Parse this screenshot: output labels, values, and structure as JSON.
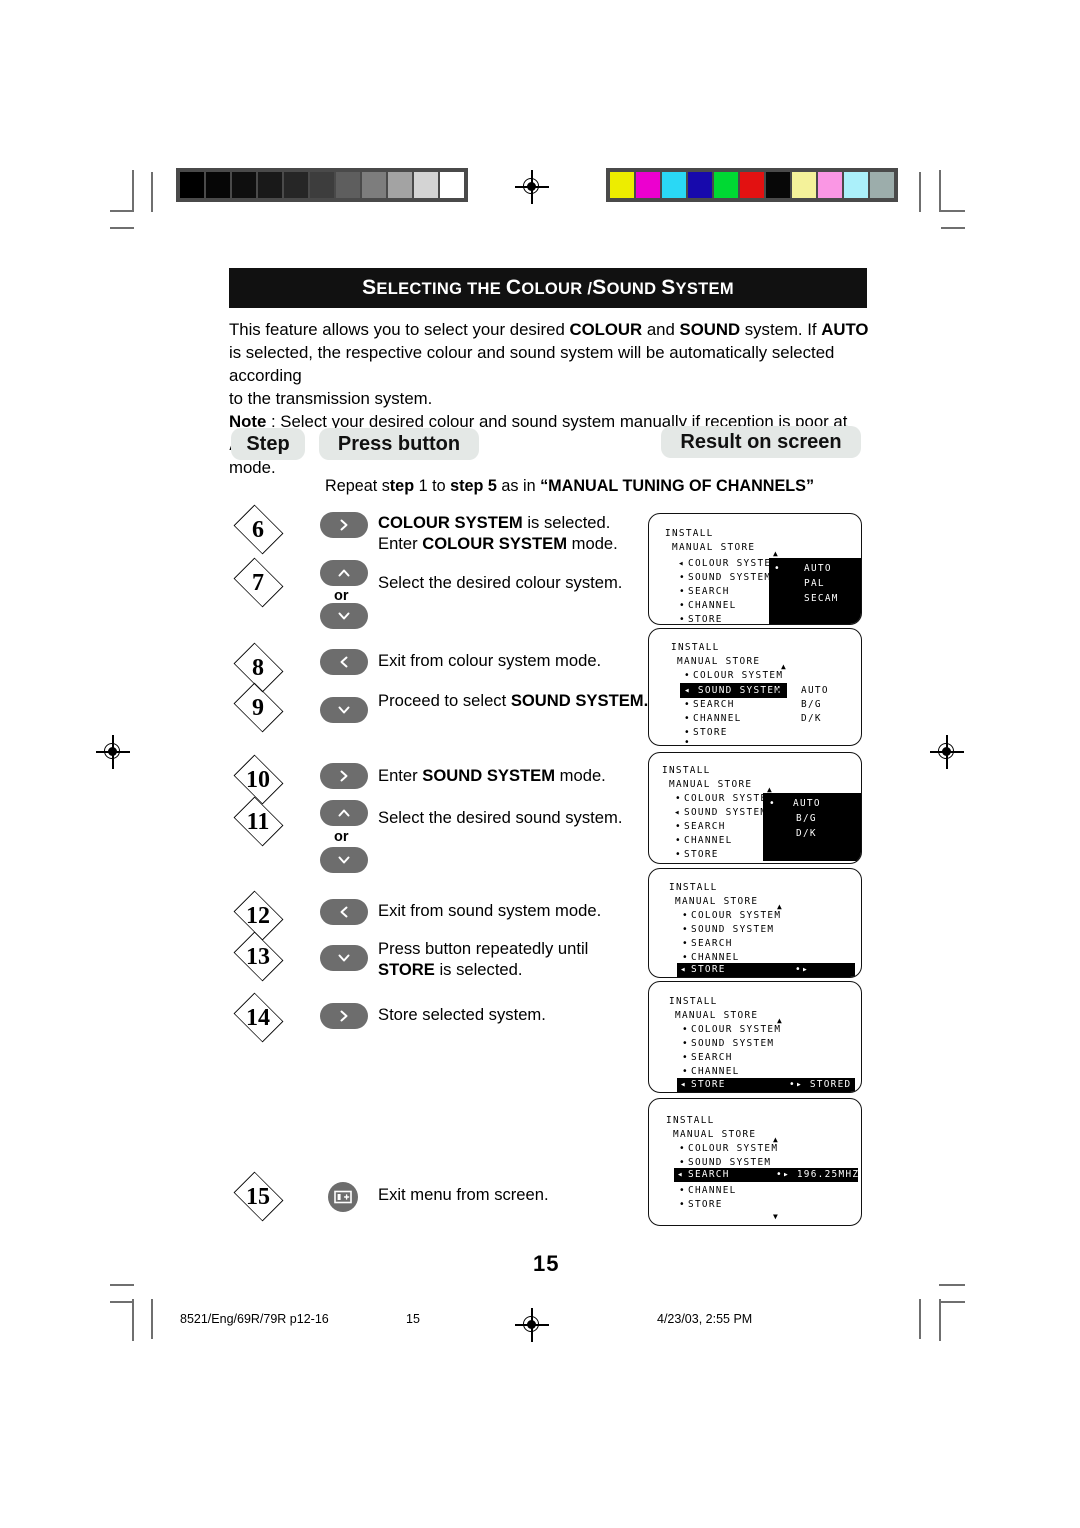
{
  "document": {
    "title": "SELECTING THE COLOUR /SOUND SYSTEM",
    "title_parts": {
      "s1": "S",
      "w1": "ELECTING THE ",
      "s2": "C",
      "w2": "OLOUR /",
      "s3": "S",
      "w3": "OUND ",
      "s4": "S",
      "w4": "YSTEM"
    },
    "page_number": "15"
  },
  "intro": {
    "l1_a": "This feature allows you to select your desired ",
    "l1_b": "COLOUR",
    "l1_c": " and ",
    "l1_d": "SOUND",
    "l1_e": " system. If ",
    "l1_f": "AUTO",
    "l2": "is selected, the respective colour and sound system will be automatically selected according",
    "l3": "to the transmission system.",
    "l4_note": "Note",
    "l4_a": " : Select your desired colour and sound system manually if reception is poor at ",
    "l4_b": "AUTO",
    "l5": "mode."
  },
  "headers": {
    "step": "Step",
    "press_button": "Press button",
    "result": "Result on screen"
  },
  "repeat_note": {
    "a": "Repeat s",
    "b": "tep",
    "c": " 1 to ",
    "d": "step 5",
    "e": " as in ",
    "f": "“MANUAL TUNING OF CHANNELS”"
  },
  "steps": [
    {
      "number": "6",
      "button": "right-arrow",
      "desc_line1_bold": "COLOUR SYSTEM",
      "desc_line1_rest": " is selected.",
      "desc_line2_pre": "Enter ",
      "desc_line2_bold": "COLOUR SYSTEM",
      "desc_line2_rest": " mode."
    },
    {
      "number": "7",
      "button": "up-down-arrow",
      "or_label": "or",
      "desc_line1_rest": "Select the desired colour system."
    },
    {
      "number": "8",
      "button": "left-arrow",
      "desc_line1_rest": "Exit from colour system mode."
    },
    {
      "number": "9",
      "button": "down-arrow",
      "desc_line1_pre": "Proceed to select ",
      "desc_line1_bold": "SOUND SYSTEM."
    },
    {
      "number": "10",
      "button": "right-arrow",
      "desc_line1_pre": "Enter ",
      "desc_line1_bold": "SOUND SYSTEM",
      "desc_line1_rest": " mode."
    },
    {
      "number": "11",
      "button": "up-down-arrow",
      "or_label": "or",
      "desc_line1_rest": "Select the desired sound system."
    },
    {
      "number": "12",
      "button": "left-arrow",
      "desc_line1_rest": "Exit from sound system mode."
    },
    {
      "number": "13",
      "button": "down-arrow",
      "desc_line1_rest": "Press button repeatedly until",
      "desc_line2_bold": "STORE",
      "desc_line2_rest": " is selected."
    },
    {
      "number": "14",
      "button": "right-arrow",
      "desc_line1_rest": "Store selected system."
    },
    {
      "number": "15",
      "button": "menu-icon",
      "desc_line1_rest": "Exit menu from screen."
    }
  ],
  "osd_screens": [
    {
      "id": "osd-1",
      "title": "INSTALL",
      "subtitle": "MANUAL STORE",
      "items": [
        "COLOUR SYSTEM",
        "SOUND SYSTEM",
        "SEARCH",
        "CHANNEL",
        "STORE"
      ],
      "cursor_item": "COLOUR SYSTEM",
      "highlight_item": null,
      "subpanel": {
        "options": [
          "AUTO",
          "PAL",
          "SECAM"
        ],
        "selected": "AUTO"
      },
      "up_caret": true,
      "down_caret": false
    },
    {
      "id": "osd-2",
      "title": "INSTALL",
      "subtitle": "MANUAL STORE",
      "items": [
        "COLOUR SYSTEM",
        "SOUND SYSTEM",
        "SEARCH",
        "CHANNEL",
        "STORE"
      ],
      "cursor_item": "SOUND SYSTEM",
      "highlight_item": "SOUND SYSTEM",
      "side_values": [
        "AUTO",
        "B/G",
        "D/K"
      ],
      "subpanel": null,
      "up_caret": true,
      "down_caret": false,
      "extra_bullet": true
    },
    {
      "id": "osd-3",
      "title": "INSTALL",
      "subtitle": "MANUAL STORE",
      "items": [
        "COLOUR SYSTEM",
        "SOUND SYSTEM",
        "SEARCH",
        "CHANNEL",
        "STORE"
      ],
      "cursor_item": "SOUND SYSTEM",
      "highlight_item": null,
      "subpanel": {
        "options": [
          "AUTO",
          "B/G",
          "D/K"
        ],
        "selected": "AUTO"
      },
      "up_caret": true,
      "down_caret": false
    },
    {
      "id": "osd-4",
      "title": "INSTALL",
      "subtitle": "MANUAL STORE",
      "items": [
        "COLOUR SYSTEM",
        "SOUND SYSTEM",
        "SEARCH",
        "CHANNEL",
        "STORE"
      ],
      "cursor_item": "STORE",
      "highlight_item": "STORE",
      "highlight_value": "•▸",
      "subpanel": null,
      "up_caret": true,
      "down_caret": false
    },
    {
      "id": "osd-5",
      "title": "INSTALL",
      "subtitle": "MANUAL STORE",
      "items": [
        "COLOUR SYSTEM",
        "SOUND SYSTEM",
        "SEARCH",
        "CHANNEL",
        "STORE"
      ],
      "cursor_item": "STORE",
      "highlight_item": "STORE",
      "highlight_value": "•▸ STORED",
      "subpanel": null,
      "up_caret": true,
      "down_caret": false
    },
    {
      "id": "osd-6",
      "title": "INSTALL",
      "subtitle": "MANUAL STORE",
      "items": [
        "COLOUR SYSTEM",
        "SOUND SYSTEM",
        "SEARCH",
        "CHANNEL",
        "STORE"
      ],
      "cursor_item": "SEARCH",
      "highlight_item": "SEARCH",
      "highlight_value": "•▸ 196.25MHZ",
      "subpanel": null,
      "up_caret": true,
      "down_caret": true
    }
  ],
  "footer": {
    "left": "8521/Eng/69R/79R p12-16",
    "center": "15",
    "right": "4/23/03, 2:55 PM"
  },
  "print_marks": {
    "grey_wedge": [
      "#000000",
      "#060606",
      "#0f0f0f",
      "#191919",
      "#262626",
      "#3d3d3d",
      "#5e5e5e",
      "#7d7d7d",
      "#a3a3a3",
      "#d4d4d4",
      "#ffffff"
    ],
    "colour_bars": [
      "#eded00",
      "#ec00cf",
      "#2ad8f5",
      "#1709ac",
      "#00d933",
      "#e21111",
      "#070707",
      "#f4f29a",
      "#fa97e4",
      "#abf0fa",
      "#9cadab"
    ]
  }
}
